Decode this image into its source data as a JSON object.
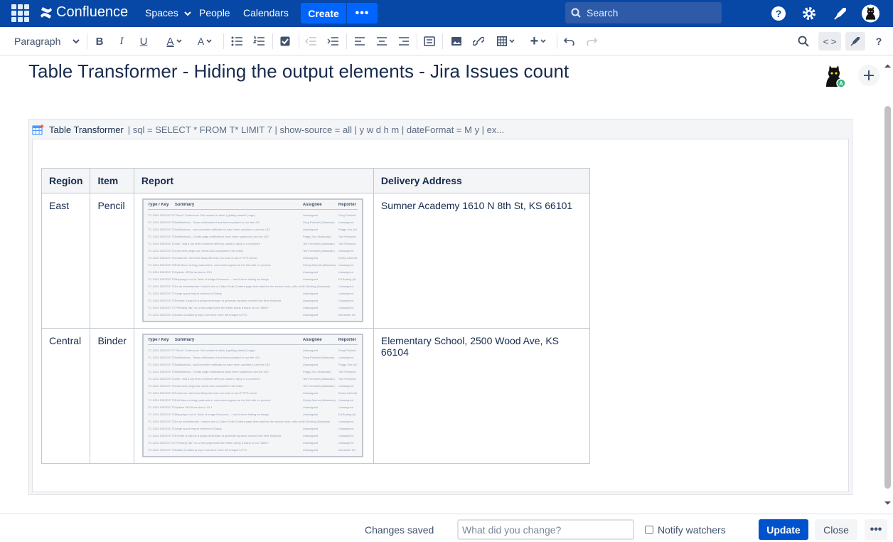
{
  "topbar": {
    "product": "Confluence",
    "nav": [
      "Spaces",
      "People",
      "Calendars"
    ],
    "create_label": "Create",
    "more_label": "•••",
    "search_placeholder": "Search"
  },
  "toolbar": {
    "style_select": "Paragraph"
  },
  "page": {
    "title": "Table Transformer - Hiding the output elements - Jira Issues count"
  },
  "macro": {
    "name": "Table Transformer",
    "params": "| sql = SELECT  * FROM T* LIMIT 7 | show-source = all | y w d h m | dateFormat = M y | ex..."
  },
  "table": {
    "headers": [
      "Region",
      "Item",
      "Report",
      "Delivery Address"
    ],
    "rows": [
      {
        "region": "East",
        "item": "Pencil",
        "address": "Sumner Academy 1610 N 8th St, KS 66101"
      },
      {
        "region": "Central",
        "item": "Binder",
        "address": "Elementary School, 2500 Wood Ave, KS 66104"
      }
    ],
    "report_image": {
      "headers": [
        "Type / Key",
        "Summary",
        "Assignee",
        "Reporter"
      ],
      "rows": [
        {
          "key": "TC-1234 DS/ODS TC-0231",
          "summary": "\"Show\" Confluence Cell created in table (\"getting started\" page)",
          "assignee": "Unassigned",
          "reporter": "Greg Pritchett"
        },
        {
          "key": "TC-1234 DS/ODS TC-0221",
          "summary": "Notifications - Team notifications have been updated to use the UDI",
          "assignee": "Greg Pritchett (Atlassian)",
          "reporter": "Unassigned"
        },
        {
          "key": "TC-1234 DS/ODS TC-0227",
          "summary": "Notifications - add comment notifications have been updated to use the UDI",
          "assignee": "Unassigned",
          "reporter": "Peggy Xue (At"
        },
        {
          "key": "TC-1234 DS/ODS TC-0220",
          "summary": "Notifications - Create page notifications have been updated to use the UDI",
          "assignee": "Peggy Xue (Atlassian)",
          "reporter": "Ted Fortowich"
        },
        {
          "key": "TC-1234 DS/ODS TC-0222",
          "summary": "Use I add a top level comment after you want to reply to a comment",
          "assignee": "Ted Fortowich (Atlassian)",
          "reporter": "Ted Fortowich"
        },
        {
          "key": "TC-1234 DS/ODS TC-0130",
          "summary": "Comment plugin can break auto-complete in the editor",
          "assignee": "Ted Fortowich (Atlassian)",
          "reporter": "Unassigned"
        },
        {
          "key": "TC-1234 DS/ODS TC-0147",
          "summary": "Customer note from Blueprint does not work on an HTTPS server",
          "assignee": "Unassigned",
          "reporter": "Sheryl Abernat"
        },
        {
          "key": "TC-1234 DS/ODS TC-0276",
          "summary": "Edit Macro during parameters, comments appear as the link with no preview",
          "assignee": "Sheryl Abernat (Atlassian)",
          "reporter": "Unassigned"
        },
        {
          "key": "TC-1234 DS/ODS TC-0242",
          "summary": "Update UPGA version to 13.1",
          "assignee": "Unassigned",
          "reporter": "Unassigned"
        },
        {
          "key": "TC-1234 DS/ODS TC-0243",
          "summary": "Mapping is not in Table of Image Resource — lost it when linking an image",
          "assignee": "Unassigned",
          "reporter": "Ed Burling (At"
        },
        {
          "key": "TC-1234 DS/ODS TC-0404",
          "summary": "As an administrator I should see a 2-label Cells Content page that matches the source tools, cells scheme page",
          "assignee": "Ed Burling (Atlassian)",
          "reporter": "Unassigned"
        },
        {
          "key": "TC-1234 DS/ODS TC-0411",
          "summary": "Large space import renders in Dialog",
          "assignee": "Unassigned",
          "reporter": "Unassigned"
        },
        {
          "key": "TC-1234 DS/ODS TC-0447",
          "summary": "Provide a way for a plugin developer to generate dynamic content into their blueprint",
          "assignee": "Unassigned",
          "reporter": "Unassigned"
        },
        {
          "key": "TC-1234 DS/ODS TC-0444",
          "summary": "\"Pressing Tab\" on a new page leads the editor along a blank on our Table?",
          "assignee": "Unassigned",
          "reporter": "Unassigned"
        },
        {
          "key": "TC-1234 DS/ODS TC-0416",
          "summary": "Added Cookies groups now have more left images to P.O.",
          "assignee": "Unassigned",
          "reporter": "Alexander De"
        }
      ]
    }
  },
  "footer": {
    "status": "Changes saved",
    "comment_placeholder": "What did you change?",
    "notify_label": "Notify watchers",
    "update_label": "Update",
    "close_label": "Close",
    "more_label": "•••"
  },
  "colors": {
    "topbar": "#0747a6",
    "primary": "#0052cc",
    "create": "#0065ff"
  }
}
